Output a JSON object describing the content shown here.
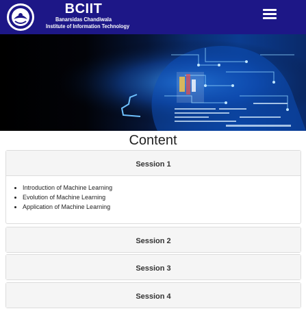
{
  "header": {
    "title": "BCIIT",
    "subtitle_line1": "Banarsidas Chandiwala",
    "subtitle_line2": "Institute of Information Technology",
    "background_color": "#1d1787",
    "logo_icon": "institute-emblem-icon",
    "menu_icon": "hamburger-menu-icon"
  },
  "hero": {
    "image": "ai-robot-head-circuit-banner"
  },
  "content": {
    "heading": "Content",
    "sessions": [
      {
        "title": "Session 1",
        "expanded": true,
        "items": [
          "Introduction of Machine Learning",
          "Evolution of Machine Learning",
          "Application of Machine Learning"
        ]
      },
      {
        "title": "Session 2",
        "expanded": false
      },
      {
        "title": "Session 3",
        "expanded": false
      },
      {
        "title": "Session 4",
        "expanded": false
      }
    ]
  }
}
